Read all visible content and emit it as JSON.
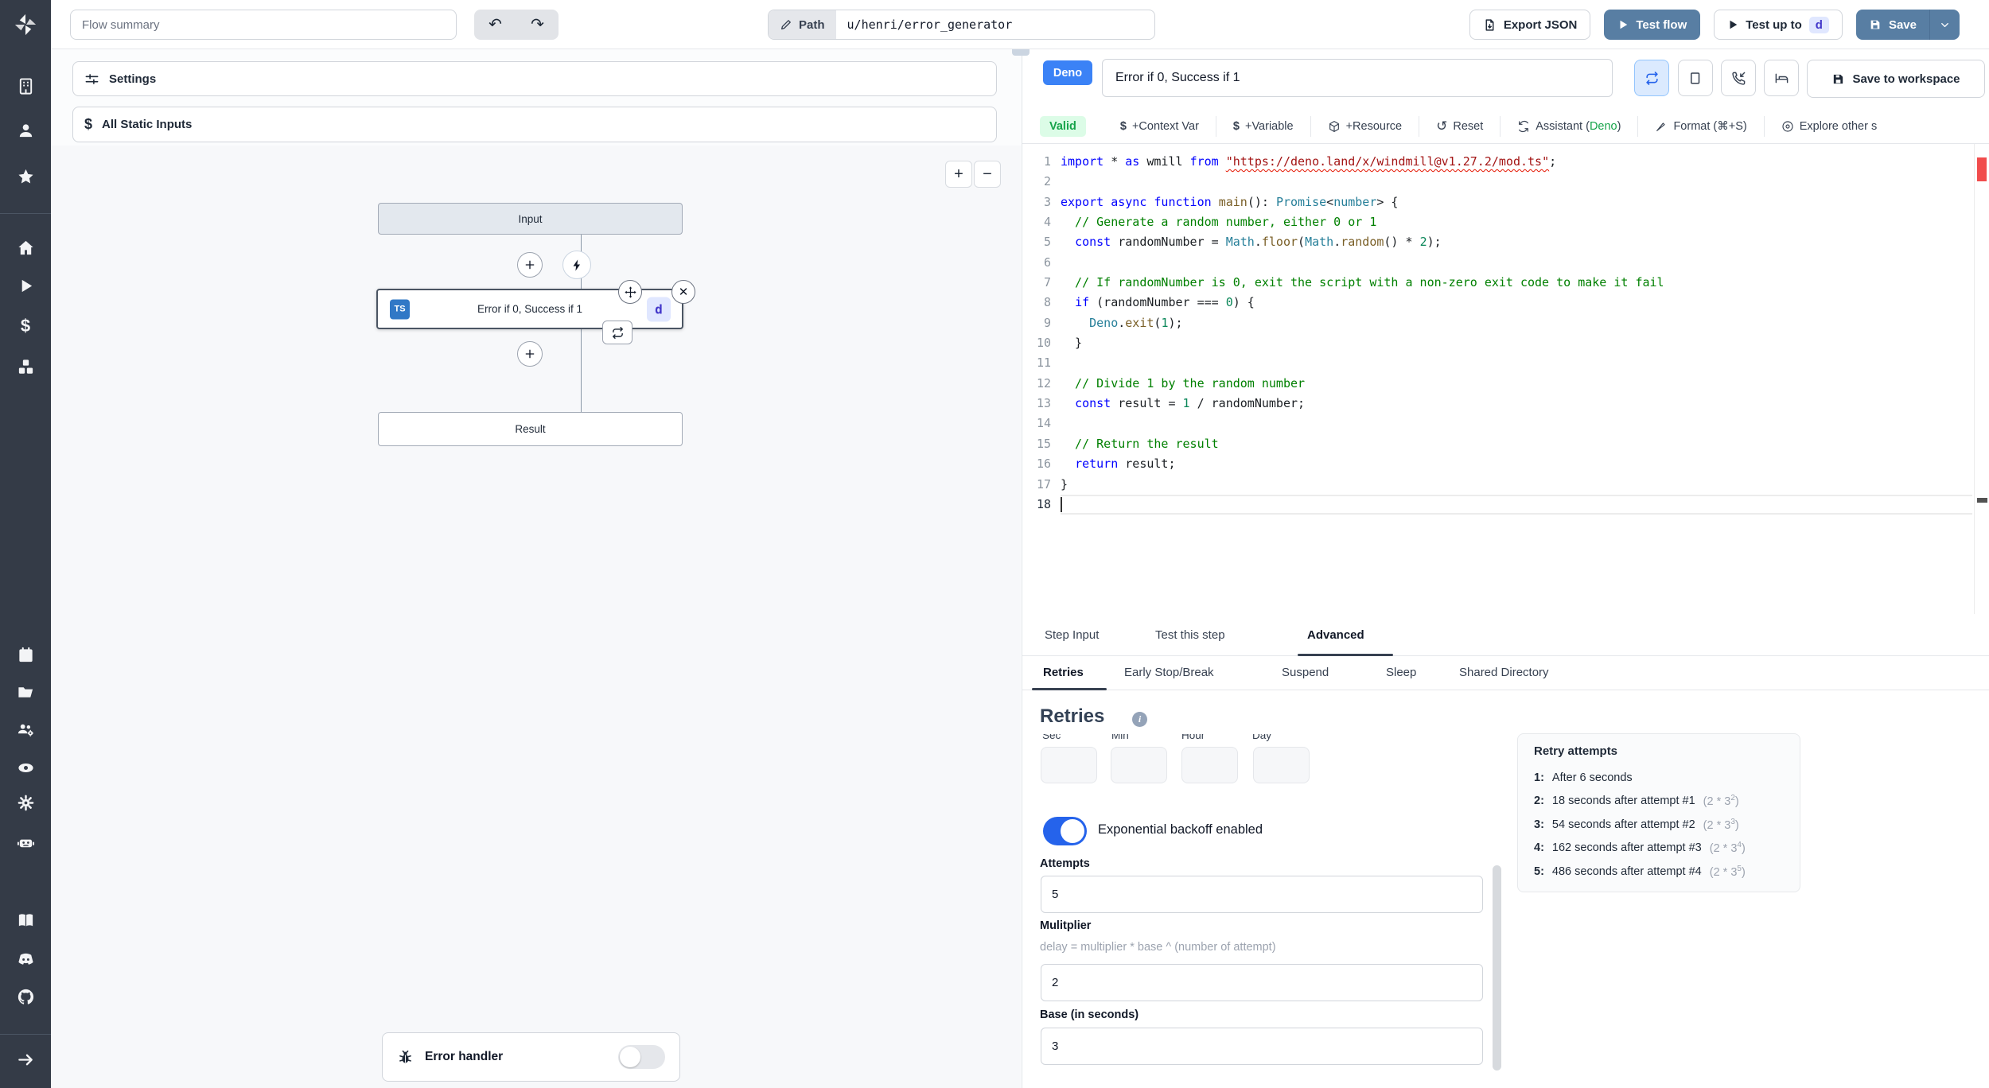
{
  "topbar": {
    "flow_summary": "Flow summary",
    "undo": "↶",
    "redo": "↷",
    "path_label": "Path",
    "path_value": "u/henri/error_generator",
    "export_json_label": "Export JSON",
    "test_flow_label": "Test flow",
    "test_up_to_label": "Test up to",
    "test_up_to_badge": "d",
    "save_label": "Save"
  },
  "left_panel": {
    "settings_label": "Settings",
    "static_inputs_label": "All Static Inputs",
    "static_inputs_icon": "$",
    "zoom_in": "+",
    "zoom_out": "−",
    "graph": {
      "input_label": "Input",
      "step": {
        "lang": "TS",
        "title": "Error if 0, Success if 1",
        "badge": "d",
        "close": "✕"
      },
      "result_label": "Result"
    },
    "error_handler_label": "Error handler"
  },
  "step_editor": {
    "lang_badge": "Deno",
    "title": "Error if 0, Success if 1",
    "save_to_workspace": "Save to workspace",
    "toolbar": {
      "valid": "Valid",
      "context_var_icon": "$",
      "context_var": "+Context Var",
      "variable_icon": "$",
      "variable": "+Variable",
      "resource": "+Resource",
      "reset_icon": "↺",
      "reset": "Reset",
      "assistant": "Assistant (",
      "assistant_lang": "Deno",
      "assistant_close": ")",
      "format": "Format (⌘+S)",
      "explore": "Explore other s"
    },
    "code": {
      "current_line": 18,
      "lines": [
        {
          "num": 1,
          "tokens": [
            [
              "k",
              "import "
            ],
            [
              "p",
              "* "
            ],
            [
              "k",
              "as "
            ],
            [
              "p",
              "wmill "
            ],
            [
              "k",
              "from "
            ],
            [
              "q",
              "\"https://deno.land/x/windmill@v1.27.2/mod.ts\""
            ],
            [
              "p",
              ";"
            ]
          ]
        },
        {
          "num": 2,
          "tokens": []
        },
        {
          "num": 3,
          "tokens": [
            [
              "k",
              "export "
            ],
            [
              "k",
              "async "
            ],
            [
              "k",
              "function "
            ],
            [
              "f",
              "main"
            ],
            [
              "p",
              "(): "
            ],
            [
              "t",
              "Promise"
            ],
            [
              "p",
              "<"
            ],
            [
              "t",
              "number"
            ],
            [
              "p",
              "> {"
            ]
          ]
        },
        {
          "num": 4,
          "tokens": [
            [
              "c",
              "  // Generate a random number, either 0 or 1"
            ]
          ]
        },
        {
          "num": 5,
          "tokens": [
            [
              "p",
              "  "
            ],
            [
              "k",
              "const"
            ],
            [
              "p",
              " randomNumber = "
            ],
            [
              "t",
              "Math"
            ],
            [
              "p",
              "."
            ],
            [
              "f",
              "floor"
            ],
            [
              "p",
              "("
            ],
            [
              "t",
              "Math"
            ],
            [
              "p",
              "."
            ],
            [
              "f",
              "random"
            ],
            [
              "p",
              "() * "
            ],
            [
              "n",
              "2"
            ],
            [
              "p",
              ");"
            ]
          ]
        },
        {
          "num": 6,
          "tokens": []
        },
        {
          "num": 7,
          "tokens": [
            [
              "c",
              "  // If randomNumber is 0, exit the script with a non-zero exit code to make it fail"
            ]
          ]
        },
        {
          "num": 8,
          "tokens": [
            [
              "p",
              "  "
            ],
            [
              "k",
              "if"
            ],
            [
              "p",
              " (randomNumber === "
            ],
            [
              "n",
              "0"
            ],
            [
              "p",
              ") {"
            ]
          ]
        },
        {
          "num": 9,
          "tokens": [
            [
              "p",
              "    "
            ],
            [
              "t",
              "Deno"
            ],
            [
              "p",
              "."
            ],
            [
              "f",
              "exit"
            ],
            [
              "p",
              "("
            ],
            [
              "n",
              "1"
            ],
            [
              "p",
              ");"
            ]
          ]
        },
        {
          "num": 10,
          "tokens": [
            [
              "p",
              "  }"
            ]
          ]
        },
        {
          "num": 11,
          "tokens": []
        },
        {
          "num": 12,
          "tokens": [
            [
              "c",
              "  // Divide 1 by the random number"
            ]
          ]
        },
        {
          "num": 13,
          "tokens": [
            [
              "p",
              "  "
            ],
            [
              "k",
              "const"
            ],
            [
              "p",
              " result = "
            ],
            [
              "n",
              "1"
            ],
            [
              "p",
              " / randomNumber;"
            ]
          ]
        },
        {
          "num": 14,
          "tokens": []
        },
        {
          "num": 15,
          "tokens": [
            [
              "c",
              "  // Return the result"
            ]
          ]
        },
        {
          "num": 16,
          "tokens": [
            [
              "p",
              "  "
            ],
            [
              "k",
              "return"
            ],
            [
              "p",
              " result;"
            ]
          ]
        },
        {
          "num": 17,
          "tokens": [
            [
              "p",
              "}"
            ]
          ]
        },
        {
          "num": 18,
          "tokens": []
        }
      ]
    }
  },
  "tabs": {
    "step_input": "Step Input",
    "test_this_step": "Test this step",
    "advanced": "Advanced",
    "retries": "Retries",
    "early_stop": "Early Stop/Break",
    "suspend": "Suspend",
    "sleep": "Sleep",
    "shared_directory": "Shared Directory"
  },
  "retries": {
    "heading": "Retries",
    "info_icon": "i",
    "time_labels": [
      "Sec",
      "Min",
      "Hour",
      "Day"
    ],
    "exponential_label": "Exponential backoff enabled",
    "attempts_label": "Attempts",
    "attempts_value": "5",
    "multiplier_label": "Mulitplier",
    "multiplier_hint": "delay = multiplier * base ^ (number of attempt)",
    "multiplier_value": "2",
    "base_label": "Base (in seconds)",
    "base_value": "3",
    "retry_attempts": {
      "title": "Retry attempts",
      "items": [
        {
          "n": "1:",
          "text": "After 6 seconds",
          "f": "",
          "e": "",
          "fc": ""
        },
        {
          "n": "2:",
          "text": "18 seconds after attempt #1",
          "f": "(2 * 3",
          "e": "2",
          "fc": ")"
        },
        {
          "n": "3:",
          "text": "54 seconds after attempt #2",
          "f": "(2 * 3",
          "e": "3",
          "fc": ")"
        },
        {
          "n": "4:",
          "text": "162 seconds after attempt #3",
          "f": "(2 * 3",
          "e": "4",
          "fc": ")"
        },
        {
          "n": "5:",
          "text": "486 seconds after attempt #4",
          "f": "(2 * 3",
          "e": "5",
          "fc": ")"
        }
      ]
    }
  },
  "colors": {
    "sidebar_bg": "#343b47",
    "primary_button": "#587EA3",
    "deno_badge": "#3b82f6",
    "ts_badge": "#3178c6",
    "valid_bg": "#dcfce7",
    "valid_text": "#16a34a",
    "toggle_on": "#2563eb",
    "error_squiggle": "#e51400"
  }
}
